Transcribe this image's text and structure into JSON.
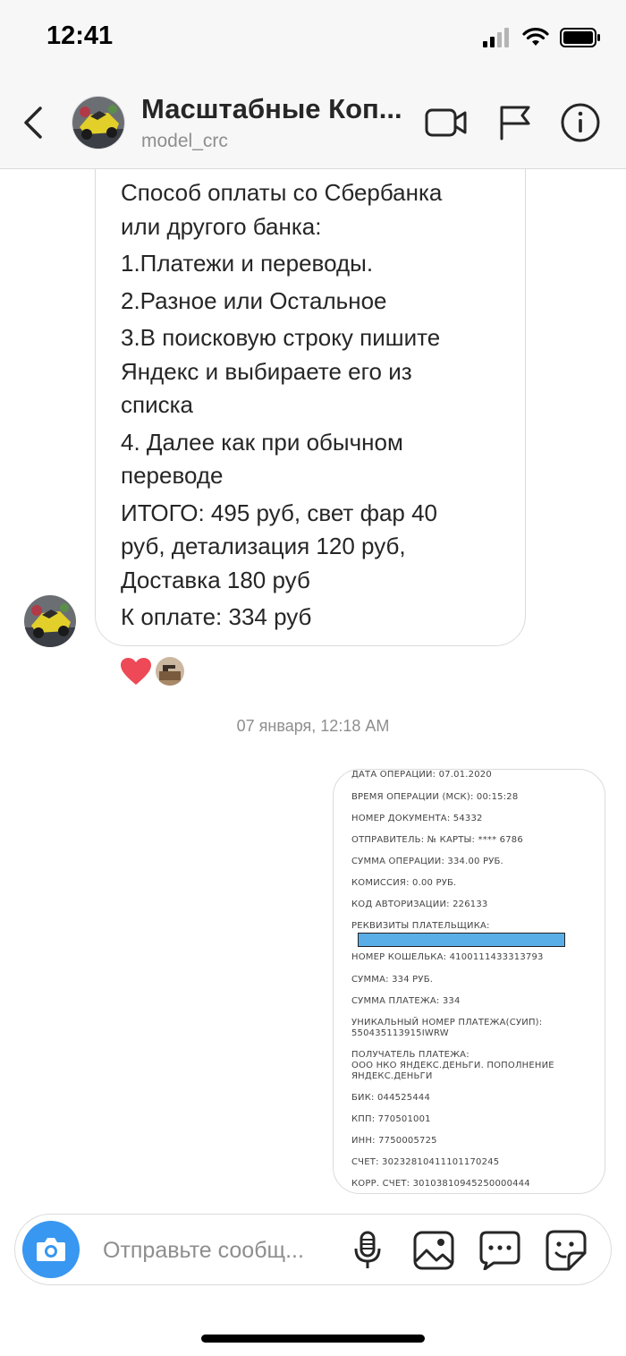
{
  "status_bar": {
    "time": "12:41"
  },
  "header": {
    "title": "Масштабные Коп...",
    "username": "model_crc"
  },
  "message": {
    "lines": [
      "Способ оплаты со Сбербанка",
      "или другого банка:",
      "1.Платежи и переводы.",
      "2.Разное или Остальное",
      "3.В поисковую строку пишите",
      "Яндекс и выбираете его из",
      "списка",
      "4. Далее как при обычном",
      "переводе",
      "ИТОГО: 495 руб, свет фар 40",
      "руб, детализация 120 руб,",
      "Доставка 180 руб",
      "К оплате: 334 руб"
    ],
    "reaction": "heart-icon"
  },
  "timestamp": "07 января, 12:18 AM",
  "receipt": {
    "lines": [
      "ДАТА ОПЕРАЦИИ: 07.01.2020",
      "ВРЕМЯ ОПЕРАЦИИ (МСК): 00:15:28",
      "НОМЕР ДОКУМЕНТА: 54332",
      "ОТПРАВИТЕЛЬ: № КАРТЫ: **** 6786",
      "СУММА ОПЕРАЦИИ: 334.00 РУБ.",
      "КОМИССИЯ: 0.00 РУБ.",
      "КОД АВТОРИЗАЦИИ: 226133",
      "РЕКВИЗИТЫ ПЛАТЕЛЬЩИКА:",
      "НОМЕР КОШЕЛЬКА: 4100111433313793",
      "СУММА: 334 РУБ.",
      "СУММА ПЛАТЕЖА: 334",
      "УНИКАЛЬНЫЙ НОМЕР ПЛАТЕЖА(СУИП):",
      "550435113915IWRW",
      "ПОЛУЧАТЕЛЬ ПЛАТЕЖА:",
      "ООО НКО  ЯНДЕКС.ДЕНЬГИ. ПОПОЛНЕНИЕ",
      "ЯНДЕКС.ДЕНЬГИ",
      "БИК: 044525444",
      "КПП: 770501001",
      "ИНН: 7750005725",
      "СЧЕТ: 30232810411101170245",
      "КОРР. СЧЕТ: 30103810945250000444"
    ]
  },
  "composer": {
    "placeholder": "Отправьте сообщ..."
  },
  "colors": {
    "accent": "#3897f0",
    "heart": "#ed4956",
    "redaction": "#5aaee8",
    "muted_text": "#8e8e8e"
  }
}
